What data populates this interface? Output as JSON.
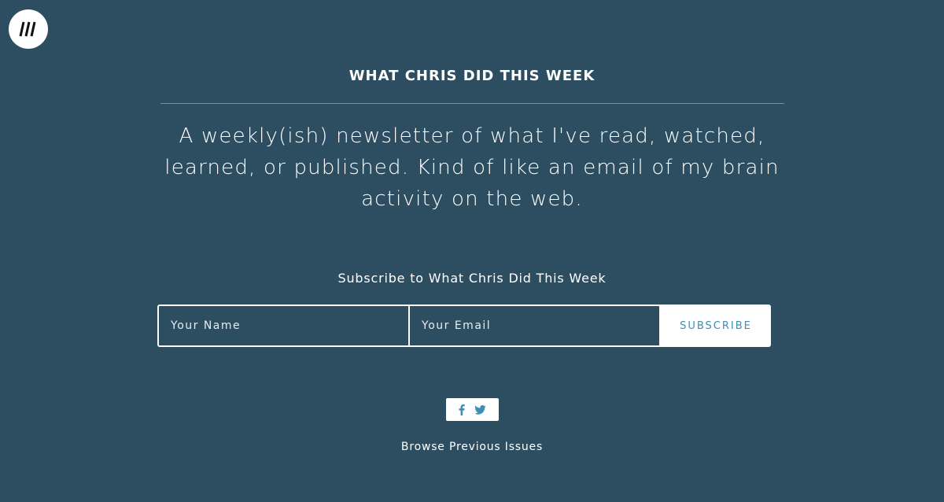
{
  "logo": {
    "icon": "triple-slash-logo-icon"
  },
  "newsletter": {
    "title": "WHAT CHRIS DID THIS WEEK",
    "description": "A weekly(ish) newsletter of what I've read, watched, learned, or published. Kind of like an email of my brain activity on the web."
  },
  "form": {
    "heading": "Subscribe to What Chris Did This Week",
    "name_placeholder": "Your Name",
    "email_placeholder": "Your Email",
    "submit_label": "SUBSCRIBE"
  },
  "share": {
    "icons": [
      "facebook-icon",
      "twitter-icon"
    ],
    "accent": "#3c8fb5"
  },
  "footer": {
    "browse_label": "Browse Previous Issues"
  },
  "colors": {
    "background": "#2d4e61",
    "text": "#ffffff",
    "accent": "#3c8fb5"
  }
}
